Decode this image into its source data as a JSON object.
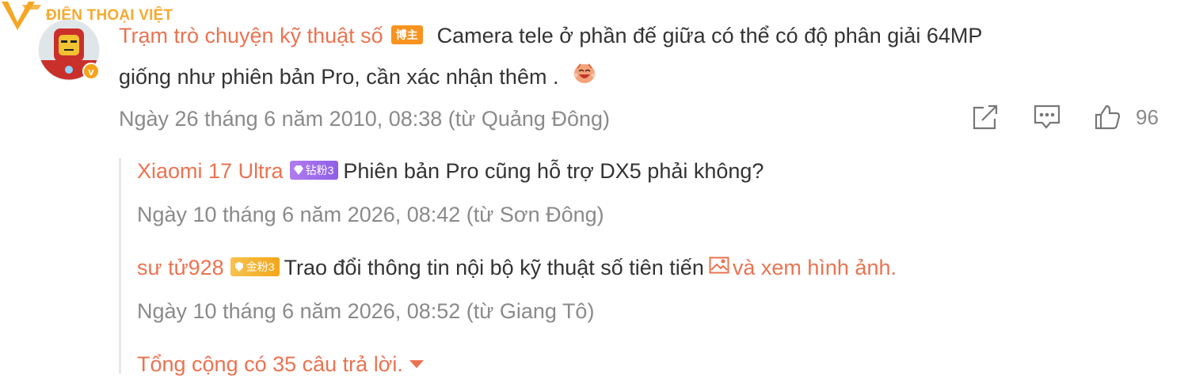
{
  "watermark": {
    "text": "ĐIỆN THOẠI VIỆT"
  },
  "post": {
    "author": "Trạm trò chuyện kỹ thuật số",
    "author_badge": "博主",
    "text_line1": "Camera tele ở phần đế giữa có thể có độ phân giải 64MP",
    "text_line2": "giống như phiên bản Pro, cần xác nhận thêm .",
    "meta": "Ngày 26 tháng 6 năm 2010, 08:38 (từ Quảng Đông)",
    "likes": "96",
    "avatar_badge": "v"
  },
  "replies": [
    {
      "author": "Xiaomi 17 Ultra",
      "badge": "钻粉3",
      "text": "Phiên  bản Pro cũng hỗ trợ DX5 phải không?",
      "meta": "Ngày 10 tháng 6 năm 2026, 08:42 (từ Sơn Đông)"
    },
    {
      "author": "sư tử928",
      "badge": "金粉3",
      "text": "Trao đổi thông tin nội bộ kỹ thuật số  tiên tiến",
      "link": "và xem hình ảnh.",
      "meta": "Ngày 10 tháng 6 năm 2026, 08:52 (từ Giang Tô)"
    }
  ],
  "total_replies": "Tổng cộng có 35 câu trả lời.",
  "colors": {
    "accent": "#eb7350",
    "meta": "#8a8a8a",
    "badge_host": "#f7931e",
    "badge_fan": "#9b6be8",
    "badge_gold": "#f2a71b"
  },
  "icons": [
    "logo-v-icon",
    "verified-badge-icon",
    "laughing-emoji-icon",
    "share-icon",
    "comment-icon",
    "like-icon",
    "diamond-icon",
    "gold-fan-icon",
    "image-icon",
    "caret-down-icon"
  ]
}
